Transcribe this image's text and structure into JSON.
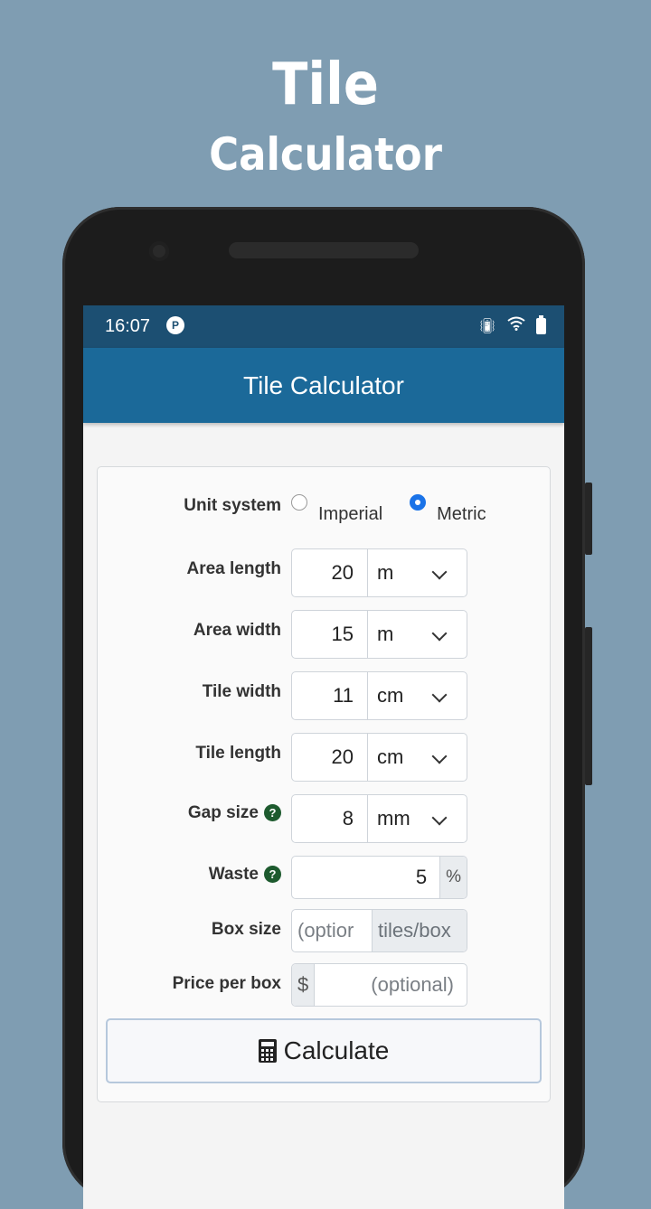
{
  "promo": {
    "line1": "Tile",
    "line2": "Calculator"
  },
  "status_bar": {
    "time": "16:07",
    "notif_letter": "P"
  },
  "app_bar": {
    "title": "Tile Calculator"
  },
  "form": {
    "unit_system": {
      "label": "Unit system",
      "options": [
        "Imperial",
        "Metric"
      ],
      "selected": "Metric"
    },
    "area_length": {
      "label": "Area length",
      "value": "20",
      "unit": "m"
    },
    "area_width": {
      "label": "Area width",
      "value": "15",
      "unit": "m"
    },
    "tile_width": {
      "label": "Tile width",
      "value": "11",
      "unit": "cm"
    },
    "tile_length": {
      "label": "Tile length",
      "value": "20",
      "unit": "cm"
    },
    "gap_size": {
      "label": "Gap size",
      "value": "8",
      "unit": "mm",
      "help": "?"
    },
    "waste": {
      "label": "Waste",
      "value": "5",
      "suffix": "%",
      "help": "?"
    },
    "box_size": {
      "label": "Box size",
      "placeholder": "(optior",
      "suffix": "tiles/box"
    },
    "price_per_box": {
      "label": "Price per box",
      "prefix": "$",
      "placeholder": "(optional)"
    },
    "calculate_label": "Calculate"
  },
  "colors": {
    "background": "#7f9db2",
    "status_bar": "#1c4f72",
    "app_bar": "#1b6999",
    "help_badge": "#1d5a2e",
    "radio_selected": "#1a73e8"
  }
}
